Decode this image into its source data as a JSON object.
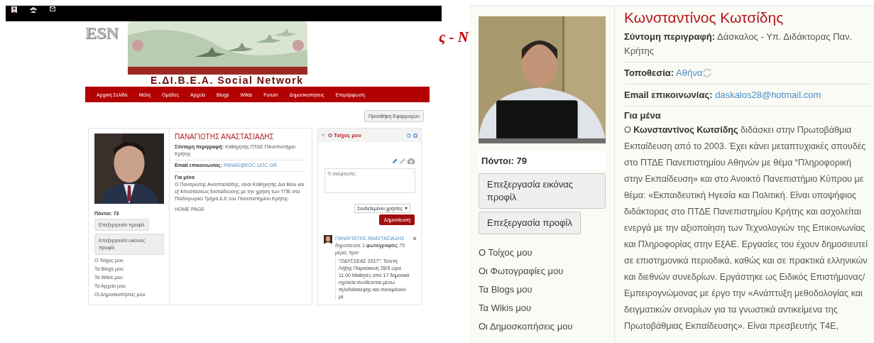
{
  "left_screenshot": {
    "site_logo": "ESN",
    "banner": {
      "kind": "picture"
    },
    "site_title": "Ε.ΔΙ.Β.Ε.Α. Social Network",
    "page_title_fragment": "ς - Ν",
    "nav": [
      "Αρχική Σελίδα",
      "Μέλη",
      "Ομάδες",
      "Αρχεία",
      "Blogs",
      "Wikis",
      "Forum",
      "Δημοσκοπήσεις",
      "Επιμόρφωση"
    ],
    "add_apps_button": "Προσθήκη Εφαρμογών",
    "profile": {
      "photo": {
        "kind": "picture"
      },
      "points": "Πόντοι: 73",
      "buttons": [
        "Επεξεργασία προφίλ",
        "Επεξεργασία εικόνας προφίλ"
      ],
      "links": [
        "Ο Τοίχος μου",
        "Τα Blogs μου",
        "Τα Wikis μου",
        "Τα Αρχεία μου",
        "Οι Δημοσκοπήσεις μου"
      ],
      "name": "ΠΑΝΑΓΙΩΤΗΣ ΑΝΑΣΤΑΣΙΑΔΗΣ",
      "fields": [
        {
          "label": "Σύντομη περιγραφή:",
          "value": "Καθηγητής ΠΤΔΕ ΠΑνεπιστήμιο Κρήτης",
          "kind": "text"
        },
        {
          "label": "Email επικοινωνίας:",
          "value": "PANAS@EDC.UOC.GR",
          "kind": "link"
        }
      ],
      "about_heading": "Για μένα",
      "about_text": "Ο Παναγιώτης Αναστασιάδης, είναι Καθηγητής Δια Βίου και εξ Αποστάσεως Εκπαίδευσης με την χρήση των ΤΠΕ στο Παιδαγωγικό Τμήμα Δ.Ε του Πανεπιστημίου Κρήτης.",
      "homepage": "HOME PAGE"
    },
    "wall": {
      "title": "Ο Τοίχος μου",
      "input": {
        "placeholder": "Τι σκέφτεστε;"
      },
      "audience": "Συνδεδεμένοι χρήστες",
      "post_button": "Δημοσίευση",
      "activity": {
        "author": "ΠΑΝΑΓΙΩΤΗΣ ΑΝΑΣΤΑΣΙΑΔΗΣ",
        "action": "δημοσίευσε 1 **φωτογραφίες** *75 μέρες πριν*",
        "text": "\"ΟΔΥΣΣΕΑΣ 2017\": Τελετή Λήξης Παρασκευή 26/5 ώρα 11.00 Μαθητές από 17 δημοτικά σχολεία συνδέονται μέσω τηλεδιάσκεψης και συνομιλούν με"
      }
    }
  },
  "right_screenshot": {
    "photo": {
      "kind": "picture"
    },
    "points": "Πόντοι: 79",
    "buttons": [
      "Επεξεργασία εικόνας προφίλ",
      "Επεξεργασία προφίλ"
    ],
    "links": [
      "Ο Τοίχος μου",
      "Οι Φωτογραφίες μου",
      "Τα Blogs μου",
      "Τα Wikis μου",
      "Οι Δημοσκοπήσεις μου"
    ],
    "name": "Κωνσταντίνος Κωτσίδης",
    "fields": [
      {
        "label": "Σύντομη περιγραφή:",
        "value": "Δάσκαλος - Υπ. Διδάκτορας Παν. Κρήτης",
        "kind": "text"
      },
      {
        "label": "Τοποθεσία:",
        "value": "Αθήνα",
        "kind": "location"
      },
      {
        "label": "Email επικοινωνίας:",
        "value": "daskalos28@hotmail.com",
        "kind": "link"
      }
    ],
    "about_heading": "Για μένα",
    "about_text": "Ο **Κωνσταντίνος Κωτσίδης** διδάσκει στην Πρωτοβάθμια Εκπαίδευση από το 2003. Έχει κάνει μεταπτυχιακές σπουδές στο ΠΤΔΕ Πανεπιστημίου Αθηνών με θέμα  “Πληροφορική στην Εκπαίδευση» και στο Ανοικτό Πανεπιστήμιο Κύπρου με θέμα: «Εκπαιδευτική Ηγεσία και Πολιτική. Είναι υποψήφιος διδάκτορας στο ΠΤΔΕ Πανεπιστημίου Κρήτης και ασχολείται ενεργά με την αξιοποίηση των Τεχνολογιών της Επικοινωνίας και Πληροφορίας στην ΕξΑΕ. Εργασίες του έχουν δημοσιευτεί σε επιστημονικά περιοδικά, καθώς και σε πρακτικά ελληνικών και διεθνών συνεδρίων. Εργάστηκε ως Ειδικός Επιστήμονας/ Εμπειρογνώμονας με έργο την «Ανάπτυξη μεθοδολογίας και δειγματικών σεναρίων για τα γνωστικά αντικείμενα της Πρωτοβάθμιας Εκπαίδευσης». Είναι πρεσβευτής T4E,"
  }
}
